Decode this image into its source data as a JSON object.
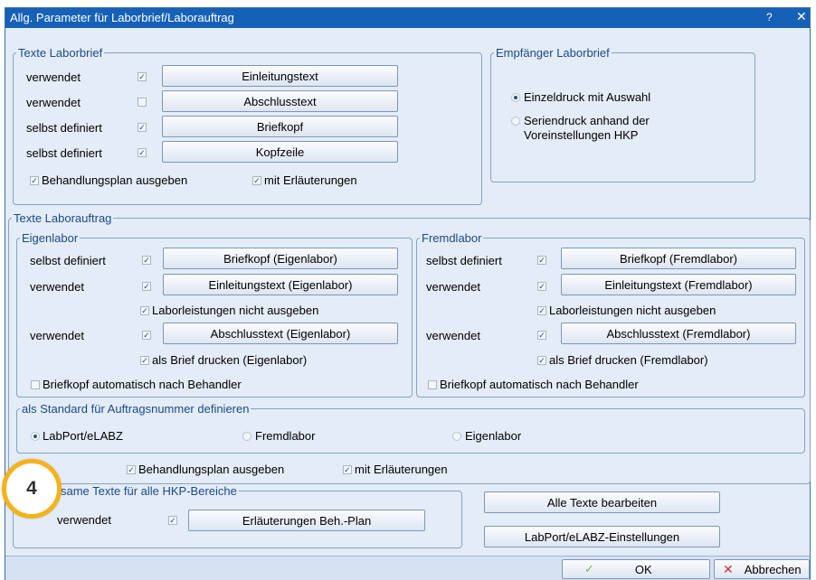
{
  "window": {
    "title": "Allg. Parameter für Laborbrief/Laborauftrag",
    "help_label": "?",
    "close_label": "✕"
  },
  "laborbrief": {
    "legend": "Texte Laborbrief",
    "rows": [
      {
        "label": "verwendet",
        "checked": true,
        "button": "Einleitungstext"
      },
      {
        "label": "verwendet",
        "checked": false,
        "button": "Abschlusstext"
      },
      {
        "label": "selbst definiert",
        "checked": true,
        "button": "Briefkopf"
      },
      {
        "label": "selbst definiert",
        "checked": true,
        "button": "Kopfzeile"
      }
    ],
    "behandlungsplan": "Behandlungsplan ausgeben",
    "erlaeuterungen": "mit Erläuterungen"
  },
  "empfaenger": {
    "legend": "Empfänger Laborbrief",
    "option1": "Einzeldruck mit Auswahl",
    "option2_line1": "Seriendruck anhand der",
    "option2_line2": "Voreinstellungen HKP"
  },
  "laborauftrag": {
    "legend": "Texte Laborauftrag",
    "eigen": {
      "legend": "Eigenlabor",
      "row1_label": "selbst definiert",
      "row1_button": "Briefkopf (Eigenlabor)",
      "row2_label": "verwendet",
      "row2_button": "Einleitungstext (Eigenlabor)",
      "leistungen": "Laborleistungen nicht ausgeben",
      "row3_label": "verwendet",
      "row3_button": "Abschlusstext (Eigenlabor)",
      "brief": "als Brief drucken (Eigenlabor)",
      "auto": "Briefkopf automatisch nach Behandler"
    },
    "fremd": {
      "legend": "Fremdlabor",
      "row1_label": "selbst definiert",
      "row1_button": "Briefkopf (Fremdlabor)",
      "row2_label": "verwendet",
      "row2_button": "Einleitungstext (Fremdlabor)",
      "leistungen": "Laborleistungen nicht ausgeben",
      "row3_label": "verwendet",
      "row3_button": "Abschlusstext (Fremdlabor)",
      "brief": "als Brief drucken (Fremdlabor)",
      "auto": "Briefkopf automatisch nach Behandler"
    },
    "standard": {
      "legend": "als Standard für Auftragsnummer definieren",
      "opt1": "LabPort/eLABZ",
      "opt2": "Fremdlabor",
      "opt3": "Eigenlabor",
      "selected": "LabPort/eLABZ"
    },
    "behandlungsplan": "Behandlungsplan ausgeben",
    "erlaeuterungen": "mit Erläuterungen"
  },
  "gemeinsam": {
    "legend": "same Texte für alle HKP-Bereiche",
    "label": "verwendet",
    "button": "Erläuterungen Beh.-Plan"
  },
  "buttons": {
    "alle_texte": "Alle Texte bearbeiten",
    "labport": "LabPort/eLABZ-Einstellungen",
    "ok": "OK",
    "abbrechen": "Abbrechen"
  },
  "badge": "4",
  "colors": {
    "titlebar": "#1661b8",
    "dialog_bg": "#e3ecf7",
    "legend": "#1c4a86",
    "badge_ring": "#f5b21b",
    "ok_check": "#7bb83a",
    "cancel_x": "#d22c2c"
  }
}
